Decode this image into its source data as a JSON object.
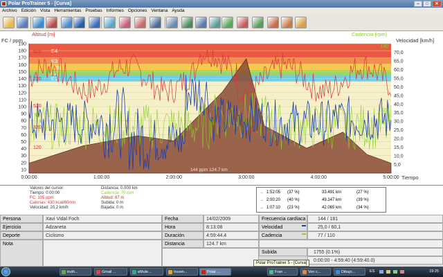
{
  "window": {
    "title": "Polar ProTrainer 5 - [Curva]",
    "controls": [
      "–",
      "□",
      "✕"
    ]
  },
  "menu": [
    "Archivo",
    "Edición",
    "Vista",
    "Herramientas",
    "Pruebas",
    "Informes",
    "Opciones",
    "Ventana",
    "Ayuda"
  ],
  "toolbar": {
    "icons": [
      "open-folder-icon",
      "save-icon",
      "find-icon",
      "person-icon",
      "calendar-icon",
      "notebook-icon",
      "diary-icon",
      "graph-icon",
      "curve-icon",
      "analysis-icon",
      "magnify-icon",
      "search-icon",
      "download-icon",
      "upload-icon",
      "sync-icon",
      "wave-icon",
      "zone-icon",
      "bar-chart-icon",
      "bar-chart2-icon",
      "bar-chart3-icon",
      "bar-chart4-icon"
    ]
  },
  "chart": {
    "y_left_label_top": "Altitud [m]",
    "y_left_label": "FC / ppm",
    "y_right_label_top": "Cadencia [rpm]",
    "y_right_label": "Velocidad [km/h]",
    "x_label": "Tiempo",
    "zones": [
      {
        "name": "E4",
        "color": "#e8402a"
      },
      {
        "name": "E3",
        "color": "#f07d3a"
      },
      {
        "name": "E2b",
        "color": "#f5c23a"
      },
      {
        "name": "E2",
        "color": "#8fd04a"
      },
      {
        "name": "E1",
        "color": "#5bc7ea"
      }
    ],
    "hr_ticks": [
      "190",
      "180",
      "170",
      "160",
      "150",
      "140",
      "130",
      "120",
      "110",
      "100",
      "90",
      "80",
      "70",
      "60",
      "50",
      "40",
      "30",
      "20",
      "10"
    ],
    "alt_ticks": [
      "920",
      "720",
      "520",
      "320",
      "120"
    ],
    "cad_ticks": [
      "180",
      "125"
    ],
    "speed_ticks": [
      "70,0",
      "65,0",
      "60,0",
      "55,0",
      "50,0",
      "45,0",
      "40,0",
      "35,0",
      "30,0",
      "25,0",
      "20,0",
      "15,0",
      "10,0",
      "5,0"
    ],
    "time_ticks": [
      "0:00:00",
      "1:00:00",
      "2:00:00",
      "3:00:00",
      "4:00:00",
      "5:00:00"
    ],
    "cursor_readout": "144 ppm 124.7 km",
    "colors": {
      "hr": "#d23a3a",
      "speed": "#1f3fa8",
      "cadence": "#8ccf2a",
      "altitude": "#8a4a35"
    }
  },
  "chart_data": {
    "type": "line",
    "x_unit": "h:mm:ss",
    "xlim": [
      "0:00:00",
      "5:00:00"
    ],
    "series": [
      {
        "name": "Altitud",
        "unit": "m",
        "x": [
          "0:00:00",
          "0:45:00",
          "1:30:00",
          "2:00:00",
          "2:40:00",
          "3:00:00",
          "3:15:00",
          "3:50:00",
          "4:20:00",
          "4:40:00",
          "5:00:00"
        ],
        "values": [
          80,
          220,
          300,
          260,
          650,
          920,
          380,
          200,
          330,
          150,
          80
        ]
      },
      {
        "name": "Frecuencia cardíaca",
        "unit": "ppm",
        "avg": 144,
        "max": 181
      },
      {
        "name": "Velocidad",
        "unit": "km/h",
        "avg": 25.0,
        "max": 60.1
      },
      {
        "name": "Cadencia",
        "unit": "rpm",
        "avg": 77,
        "max": 110
      }
    ]
  },
  "cursor": {
    "col1": [
      "Valores del cursor:",
      "Tiempo: 0:00:00",
      "FC: 105 ppm",
      "Calorías: 430 kcal/60min",
      "Velocidad: 20,2 km/h"
    ],
    "col2": [
      "Distancia: 0.000 km",
      "Cadencia: 70 rpm",
      "Altitud: 67 m",
      "Subida: 0 m",
      "Bajada: 0 m"
    ],
    "col1_colors": [
      "#333",
      "#333",
      "#c33",
      "#c33",
      "#333"
    ],
    "col2_colors": [
      "#333",
      "#8ccf2a",
      "#8a4a35",
      "#333",
      "#333"
    ]
  },
  "zone_summary": [
    {
      "time": "1:52:05",
      "pct": "(37 %)",
      "dist": "33.491 km",
      "dpct": "(27 %)",
      "color": "#e8402a"
    },
    {
      "time": "2:00:20",
      "pct": "(40 %)",
      "dist": "49.147 km",
      "dpct": "(39 %)",
      "color": "#1f7a3a"
    },
    {
      "time": "1:07:10",
      "pct": "(23 %)",
      "dist": "42.065 km",
      "dpct": "(34 %)",
      "color": "#1f3fa8"
    }
  ],
  "details": {
    "persona_label": "Persona",
    "persona": "Xavi Vidal Foch",
    "ejercicio_label": "Ejercicio",
    "ejercicio": "Adzaneta",
    "deporte_label": "Deporte",
    "deporte": "Ciclismo",
    "nota_label": "Nota",
    "fecha_label": "Fecha",
    "fecha": "14/02/2009",
    "hora_label": "Hora",
    "hora": "8:13:08",
    "duracion_label": "Duración",
    "duracion": "4:59:44.4",
    "distancia_label": "Distancia",
    "distancia": "124.7 km",
    "fc_label": "Frecuencia cardíaca",
    "fc": "144 / 181",
    "velocidad_label": "Velocidad",
    "velocidad": "25,0 / 60,1",
    "cadencia_label": "Cadencia",
    "cadencia": "77 / 110",
    "subida_label": "Subida",
    "subida": "1755 (0.1%)",
    "range": "0:00:00 - 4:59:40 (4:59:40.0)"
  },
  "tooltip": "Polar ProTrainer 5 - [Curva]",
  "taskbar": {
    "items": [
      {
        "label": "truth...",
        "color": "#6aa84f"
      },
      {
        "label": "Gmail ...",
        "color": "#d44"
      },
      {
        "label": "eMule...",
        "color": "#3a8"
      },
      {
        "label": "Incom...",
        "color": "#e2a33a"
      },
      {
        "label": "Polar ...",
        "color": "#c21"
      },
      {
        "label": "Fran ...",
        "color": "#5b8"
      },
      {
        "label": "Ven c...",
        "color": "#d84"
      },
      {
        "label": "Dibujo...",
        "color": "#48c"
      }
    ],
    "lang": "ES",
    "clock": "19:25"
  }
}
